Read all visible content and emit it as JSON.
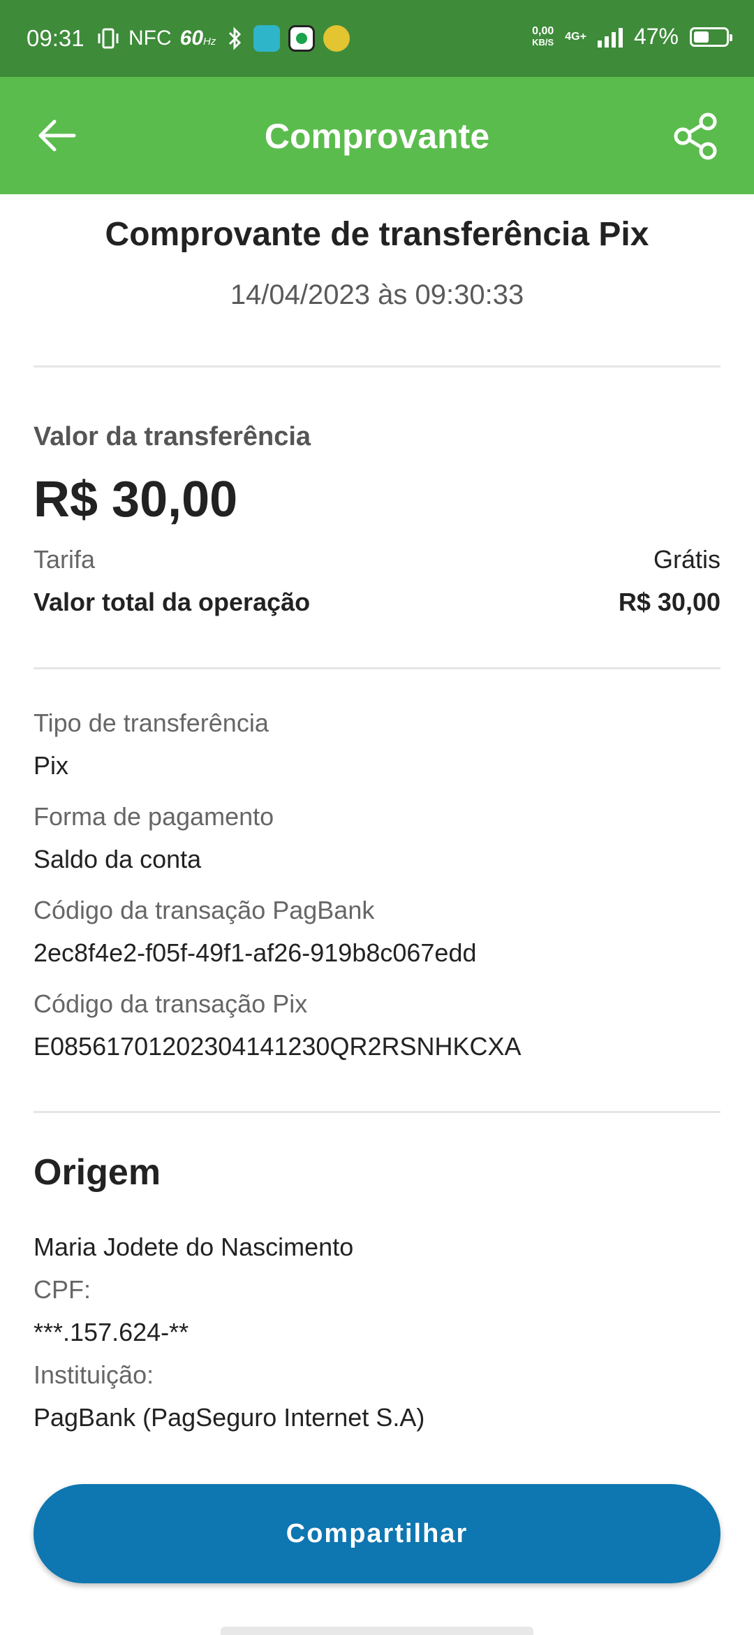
{
  "status_bar": {
    "time": "09:31",
    "nfc": "NFC",
    "refresh_rate": "60",
    "refresh_unit": "Hz",
    "net_speed_value": "0,00",
    "net_speed_unit": "KB/S",
    "network": "4G+",
    "battery_percent": "47%",
    "battery_level": 0.47
  },
  "app_bar": {
    "title": "Comprovante"
  },
  "receipt": {
    "title": "Comprovante de transferência Pix",
    "date": "14/04/2023 às 09:30:33"
  },
  "amounts": {
    "transfer_label": "Valor da transferência",
    "transfer_value": "R$ 30,00",
    "fee_label": "Tarifa",
    "fee_value": "Grátis",
    "total_label": "Valor total da operação",
    "total_value": "R$ 30,00"
  },
  "details": {
    "type_label": "Tipo de transferência",
    "type_value": "Pix",
    "payment_label": "Forma de pagamento",
    "payment_value": "Saldo da conta",
    "pagbank_code_label": "Código da transação PagBank",
    "pagbank_code_value": "2ec8f4e2-f05f-49f1-af26-919b8c067edd",
    "pix_code_label": "Código da transação Pix",
    "pix_code_value": "E08561701202304141230QR2RSNHKCXA"
  },
  "origin": {
    "title": "Origem",
    "name": "Maria Jodete do Nascimento",
    "cpf_label": "CPF:",
    "cpf_value": "***.157.624-**",
    "institution_label": "Instituição:",
    "institution_value": "PagBank (PagSeguro Internet S.A)"
  },
  "actions": {
    "share_label": "Compartilhar"
  },
  "colors": {
    "status_bar": "#3e8b3a",
    "app_bar": "#5bbc4e",
    "share_button": "#0e76b0"
  }
}
